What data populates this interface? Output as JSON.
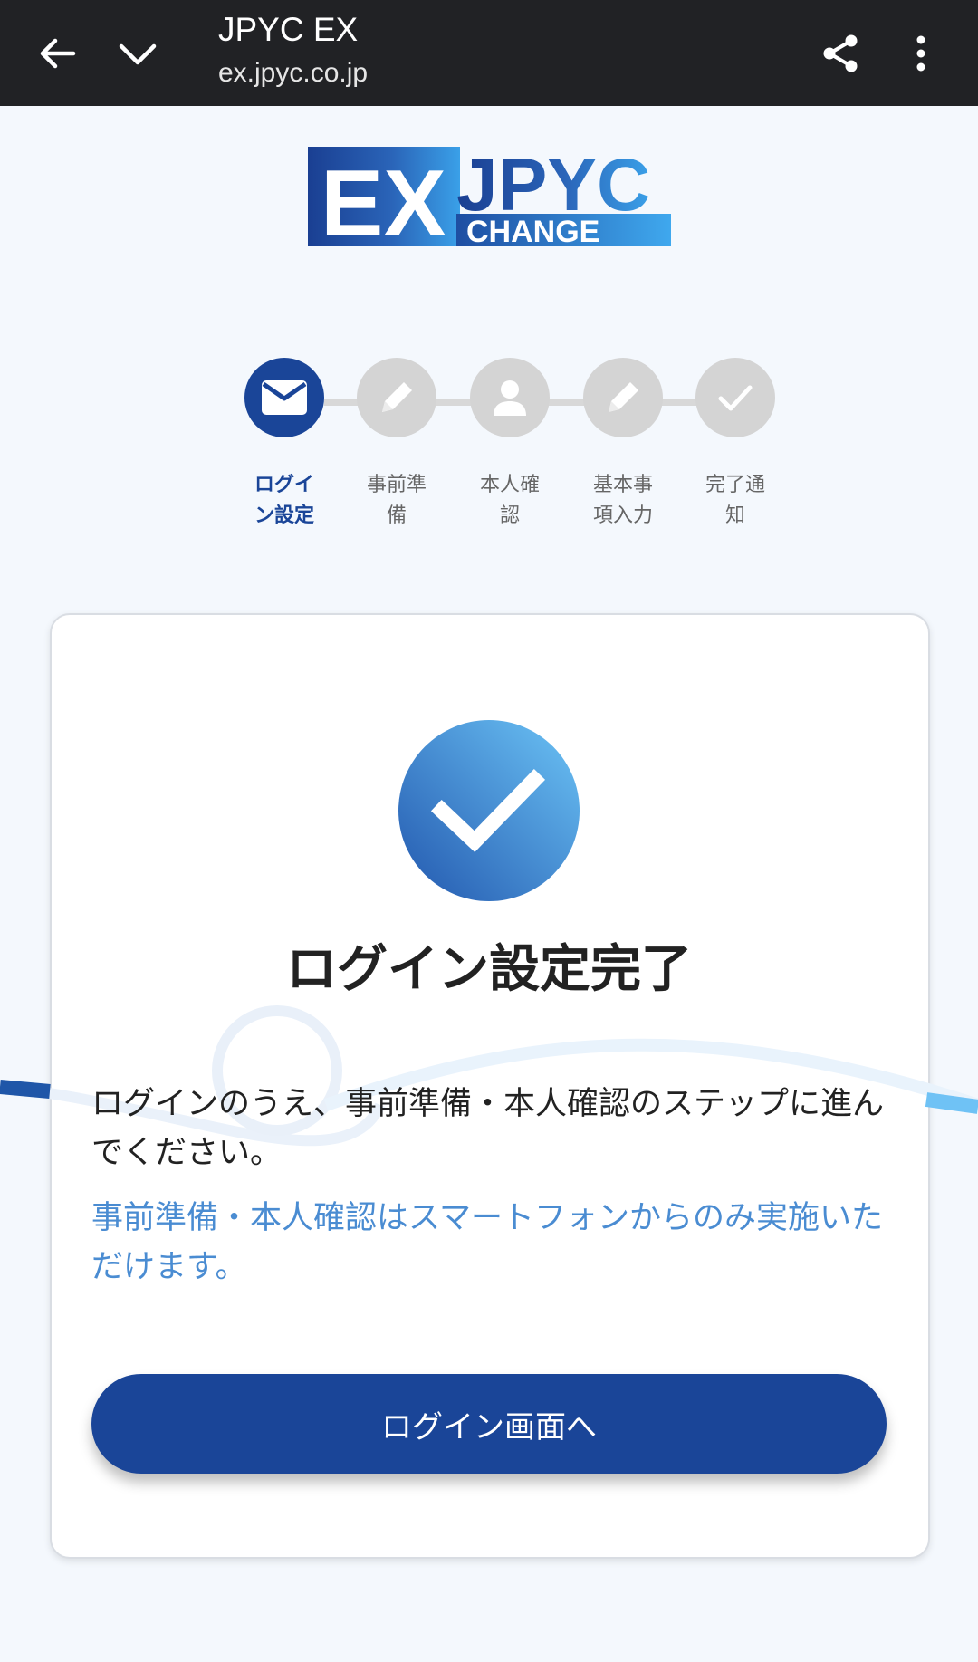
{
  "browser": {
    "title": "JPYC EX",
    "url": "ex.jpyc.co.jp",
    "back_icon": "arrow-left-icon",
    "dropdown_icon": "chevron-down-icon",
    "share_icon": "share-icon",
    "menu_icon": "more-vertical-icon"
  },
  "logo": {
    "text_ex": "EX",
    "text_jpyc": "JPYC",
    "text_change": "CHANGE"
  },
  "stepper": {
    "steps": [
      {
        "label_line1": "ログイ",
        "label_line2": "ン設定",
        "icon": "mail-icon",
        "state": "active"
      },
      {
        "label_line1": "事前準",
        "label_line2": "備",
        "icon": "pencil-icon",
        "state": "inactive"
      },
      {
        "label_line1": "本人確",
        "label_line2": "認",
        "icon": "person-icon",
        "state": "inactive"
      },
      {
        "label_line1": "基本事",
        "label_line2": "項入力",
        "icon": "pencil-icon",
        "state": "inactive"
      },
      {
        "label_line1": "完了通",
        "label_line2": "知",
        "icon": "check-icon",
        "state": "inactive"
      }
    ]
  },
  "card": {
    "title": "ログイン設定完了",
    "message": "ログインのうえ、事前準備・本人確認のステップに進んでください。",
    "note": "事前準備・本人確認はスマートフォンからのみ実施いただけます。",
    "button_label": "ログイン画面へ"
  },
  "colors": {
    "brand": "#1a4598",
    "accent": "#4a8cd2",
    "inactive": "#d4d4d4",
    "topbar": "#212225"
  }
}
